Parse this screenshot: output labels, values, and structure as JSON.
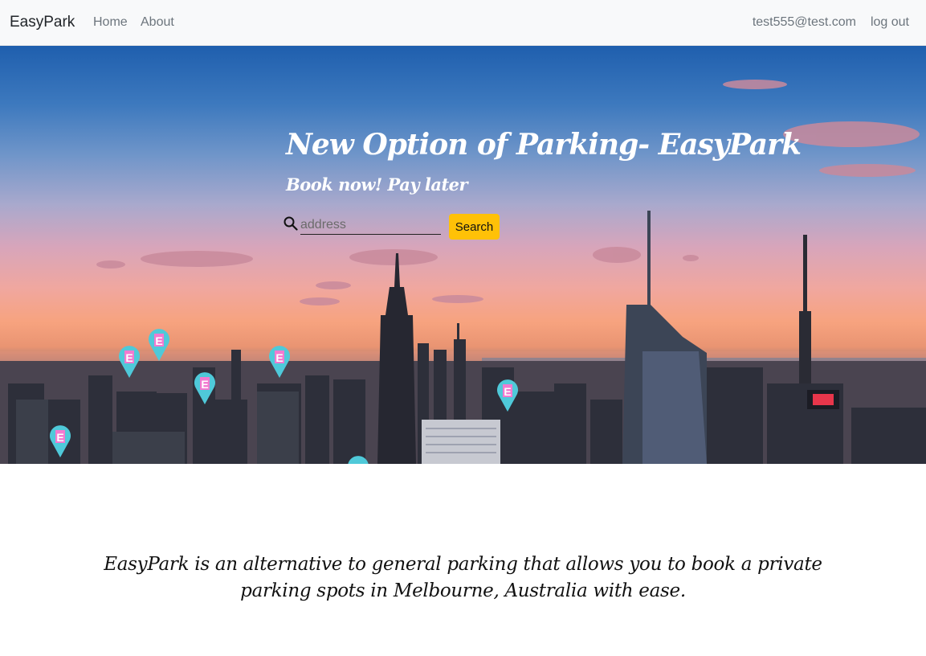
{
  "navbar": {
    "brand": "EasyPark",
    "links": [
      {
        "label": "Home"
      },
      {
        "label": "About"
      }
    ],
    "user_email": "test555@test.com",
    "logout_label": "log out"
  },
  "hero": {
    "title": "New Option of Parking- EasyPark",
    "subtitle": "Book now! Pay later",
    "search": {
      "icon": "search-icon",
      "placeholder": "address",
      "value": "",
      "button_label": "Search"
    },
    "marker_letter": "E",
    "marker_color": "#4fc9d9",
    "marker_letter_bg": "#f27ad0"
  },
  "about": {
    "text": "EasyPark is an alternative to general parking that allows you to book a private parking spots in Melbourne, Australia with ease."
  },
  "colors": {
    "accent": "#ffc107",
    "navbar_bg": "#f8f9fa"
  }
}
